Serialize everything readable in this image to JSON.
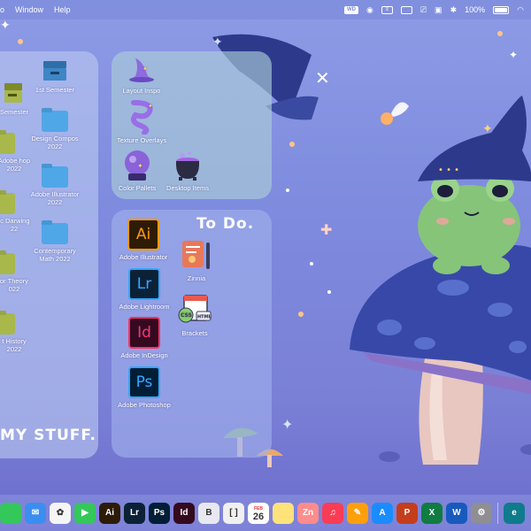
{
  "menubar": {
    "items": [
      "o",
      "Window",
      "Help"
    ],
    "status": {
      "wd_label": "WD",
      "battery_text": "100%"
    }
  },
  "panels": {
    "my_stuff_label": "MY STUFF.",
    "todo_label": "To Do."
  },
  "my_stuff": [
    {
      "label": "1st Semester",
      "kind": "archive"
    },
    {
      "label": "Semester",
      "kind": "archive-cut"
    },
    {
      "label": "Design Compos 2022",
      "kind": "folder-blue"
    },
    {
      "label": "Adobe hop 2022",
      "kind": "folder-green"
    },
    {
      "label": "Adobe Illustrator 2022",
      "kind": "folder-blue"
    },
    {
      "label": "ic Darwing 22",
      "kind": "folder-green"
    },
    {
      "label": "Contemporary Math 2022",
      "kind": "folder-blue"
    },
    {
      "label": "or Theory 022",
      "kind": "folder-green"
    },
    {
      "label": "t History 2022",
      "kind": "folder-green"
    }
  ],
  "inspo": [
    {
      "label": "Layout Inspo",
      "icon": "witch-hat-icon"
    },
    {
      "label": "Texture Overlays",
      "icon": "swirl-icon"
    },
    {
      "label": "Color Pallets",
      "icon": "crystal-ball-icon"
    },
    {
      "label": "Desktop Items",
      "icon": "cauldron-icon"
    }
  ],
  "todo": [
    {
      "label": "Adobe Illustrator",
      "abbr": "Ai"
    },
    {
      "label": "Zinnia",
      "abbr": ""
    },
    {
      "label": "Adobe Lightroom",
      "abbr": "Lr"
    },
    {
      "label": "Brackets",
      "abbr": ""
    },
    {
      "label": "Adobe InDesign",
      "abbr": "Id"
    },
    {
      "label": "Adobe Photoshop",
      "abbr": "Ps"
    }
  ],
  "dock": {
    "apps": [
      {
        "name": "messages-icon",
        "text": "",
        "color": "#34c759"
      },
      {
        "name": "mail-icon",
        "text": "✉",
        "color": "#3b8ef0"
      },
      {
        "name": "photos-icon",
        "text": "✿",
        "color": "#f5f5f5"
      },
      {
        "name": "facetime-icon",
        "text": "▶",
        "color": "#34c759"
      },
      {
        "name": "illustrator-icon",
        "text": "Ai",
        "color": "#2e1b06"
      },
      {
        "name": "lightroom-icon",
        "text": "Lr",
        "color": "#0b2236"
      },
      {
        "name": "photoshop-icon",
        "text": "Ps",
        "color": "#001e36"
      },
      {
        "name": "indesign-icon",
        "text": "Id",
        "color": "#350a1f"
      },
      {
        "name": "bbedit-icon",
        "text": "B",
        "color": "#e8e8f0"
      },
      {
        "name": "brackets-icon",
        "text": "[ ]",
        "color": "#f0f0f0"
      },
      {
        "name": "calendar-icon",
        "text": "26",
        "color": "#ffffff"
      },
      {
        "name": "notes-icon",
        "text": "",
        "color": "#ffe27a"
      },
      {
        "name": "zinnia-icon",
        "text": "Zn",
        "color": "#ff8c8c"
      },
      {
        "name": "music-icon",
        "text": "♫",
        "color": "#fa3c55"
      },
      {
        "name": "pages-icon",
        "text": "✎",
        "color": "#ff9f0a"
      },
      {
        "name": "app-store-icon",
        "text": "A",
        "color": "#1a8cff"
      },
      {
        "name": "powerpoint-icon",
        "text": "P",
        "color": "#c43e1c"
      },
      {
        "name": "excel-icon",
        "text": "X",
        "color": "#107c41"
      },
      {
        "name": "word-icon",
        "text": "W",
        "color": "#185abd"
      },
      {
        "name": "system-prefs-icon",
        "text": "⚙",
        "color": "#8e8e93"
      },
      {
        "name": "edge-icon",
        "text": "e",
        "color": "#0f7b8c"
      }
    ],
    "calendar_month": "FEB"
  }
}
